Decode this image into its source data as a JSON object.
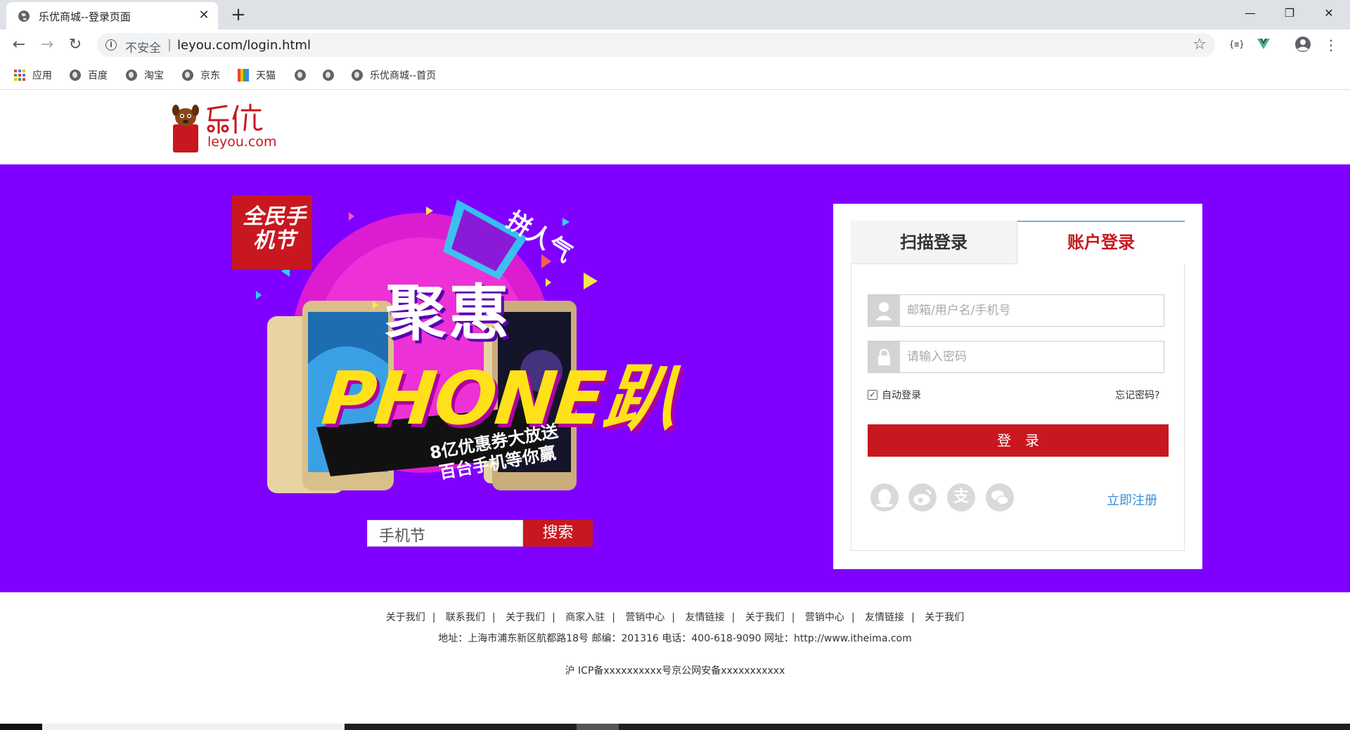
{
  "browser": {
    "tab_title": "乐优商城--登录页面",
    "close_glyph": "✕",
    "new_tab_glyph": "+",
    "window_controls": {
      "minimize": "—",
      "restore": "❐",
      "close": "✕"
    },
    "nav": {
      "back": "←",
      "forward": "→",
      "reload": "↻"
    },
    "security_label": "不安全",
    "url": "leyou.com/login.html",
    "bookmark_star": "☆",
    "menu_glyph": "⋮",
    "bookmarks": [
      {
        "label": "应用",
        "icon": "apps-grid-icon"
      },
      {
        "label": "百度",
        "icon": "globe-icon"
      },
      {
        "label": "淘宝",
        "icon": "globe-icon"
      },
      {
        "label": "京东",
        "icon": "globe-icon"
      },
      {
        "label": "天猫",
        "icon": "tmall-icon"
      },
      {
        "label": "",
        "icon": "globe-icon"
      },
      {
        "label": "",
        "icon": "globe-icon"
      },
      {
        "label": "乐优商城--首页",
        "icon": "globe-icon"
      }
    ]
  },
  "header": {
    "logo_text": "leyou.com"
  },
  "banner": {
    "badge": "全民手机节",
    "ribbon": "拼人气",
    "title": "聚惠",
    "phone_text": "PHONE趴",
    "slogan_line1": "8亿优惠券大放送",
    "slogan_line2": "百台手机等你赢",
    "search_value": "手机节",
    "search_button": "搜索"
  },
  "login": {
    "tab_scan": "扫描登录",
    "tab_account": "账户登录",
    "username_placeholder": "邮箱/用户名/手机号",
    "password_placeholder": "请输入密码",
    "remember_label": "自动登录",
    "remember_checked": true,
    "forgot_label": "忘记密码?",
    "submit_label": "登录",
    "register_label": "立即注册",
    "social_icons": [
      "qq-icon",
      "weibo-icon",
      "alipay-icon",
      "wechat-icon"
    ],
    "alipay_glyph": "支",
    "accent_color": "#c8171f",
    "link_color": "#3a8fd8"
  },
  "footer": {
    "links": [
      "关于我们",
      "联系我们",
      "关于我们",
      "商家入驻",
      "营销中心",
      "友情链接",
      "关于我们",
      "营销中心",
      "友情链接",
      "关于我们"
    ],
    "address": "地址：上海市浦东新区航都路18号 邮编：201316 电话：400-618-9090 网址：http://www.itheima.com",
    "icp": "沪 ICP备xxxxxxxxxx号京公网安备xxxxxxxxxxx"
  },
  "colors": {
    "banner_bg": "#8000ff",
    "brand_red": "#c8171f"
  }
}
